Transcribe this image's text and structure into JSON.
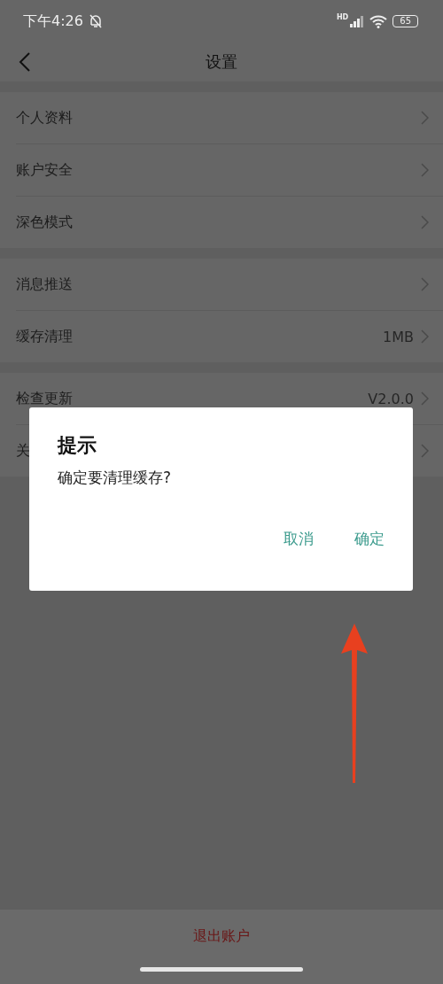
{
  "status_bar": {
    "time": "下午4:26",
    "network": "HD",
    "battery": "65"
  },
  "header": {
    "title": "设置"
  },
  "groups": [
    {
      "items": [
        {
          "label": "个人资料"
        },
        {
          "label": "账户安全"
        },
        {
          "label": "深色模式"
        }
      ]
    },
    {
      "items": [
        {
          "label": "消息推送"
        },
        {
          "label": "缓存清理",
          "value": "1MB"
        }
      ]
    },
    {
      "items": [
        {
          "label": "检查更新",
          "value": "V2.0.0"
        },
        {
          "label": "关"
        }
      ]
    }
  ],
  "dialog": {
    "title": "提示",
    "message": "确定要清理缓存?",
    "buttons": [
      "取消",
      "确定"
    ]
  },
  "logout_button": "退出账户"
}
